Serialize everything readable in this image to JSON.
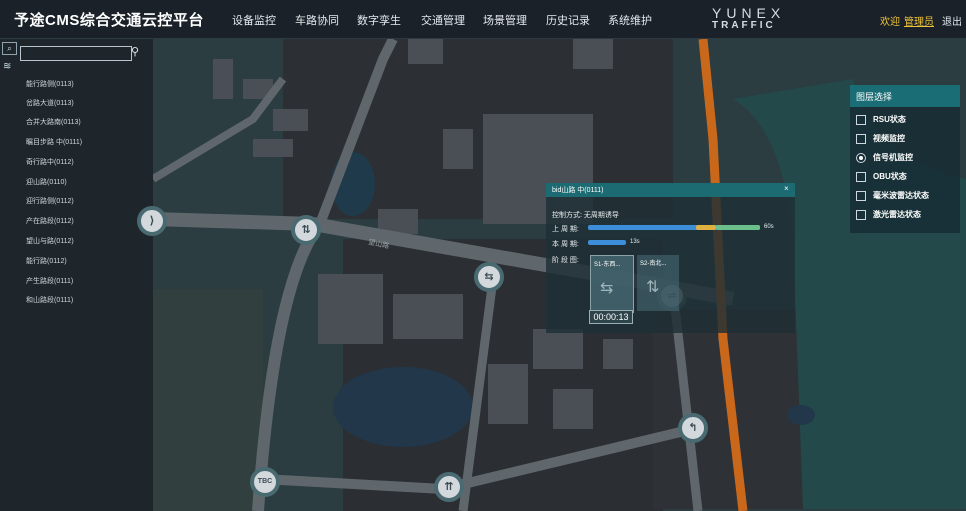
{
  "header": {
    "title": "予途CMS综合交通云控平台",
    "nav": [
      "设备监控",
      "车路协同",
      "数字孪生",
      "交通管理",
      "场景管理",
      "历史记录",
      "系统维护"
    ],
    "logo_top": "YUNEX",
    "logo_bottom": "TRAFFIC",
    "welcome": "欢迎",
    "user": "管理员",
    "logout": "退出"
  },
  "sidebar": {
    "search_placeholder": "",
    "items": [
      "能行路侧(0113)",
      "岔路大道(0113)",
      "合并大路南(0113)",
      "瞩目步路 中(0111)",
      "奇行路中(0112)",
      "迎山路(0110)",
      "迎行路侧(0112)",
      "产在路段(0112)",
      "望山与路(0112)",
      "能行路(0112)",
      "产生路段(0111)",
      "和山路段(0111)"
    ]
  },
  "layers": {
    "title": "图层选择",
    "items": [
      {
        "label": "RSU状态",
        "checked": false
      },
      {
        "label": "视频监控",
        "checked": false
      },
      {
        "label": "信号机监控",
        "checked": true
      },
      {
        "label": "OBU状态",
        "checked": false
      },
      {
        "label": "毫米波雷达状态",
        "checked": false
      },
      {
        "label": "激光雷达状态",
        "checked": false
      }
    ]
  },
  "popup": {
    "title": "bid山路 中(0111)",
    "close": "×",
    "control_mode": "控制方式: 无周期诱导",
    "row1_label": "上 周 期:",
    "row1_value": "60s",
    "row2_label": "本 周 期:",
    "row2_value": "13s",
    "row3_label": "阶 段 图:",
    "phase1": "S1-东西...",
    "phase2": "S2-南北...",
    "timer": "00:00:13"
  },
  "map": {
    "road_label": "望山路",
    "node_icons": [
      "turn-right-icon",
      "swap-icon",
      "straight-icon",
      "tbc-node",
      "split-icon",
      "left-turn-icon",
      "partial-node"
    ],
    "node_tbc_label": "TBC"
  },
  "colors": {
    "accent_teal": "#1d6b72",
    "highlight_orange": "#e8892b",
    "bar_blue": "#3d8ed8",
    "bar_green": "#6bbf8a",
    "welcome_yellow": "#f0c43a"
  }
}
